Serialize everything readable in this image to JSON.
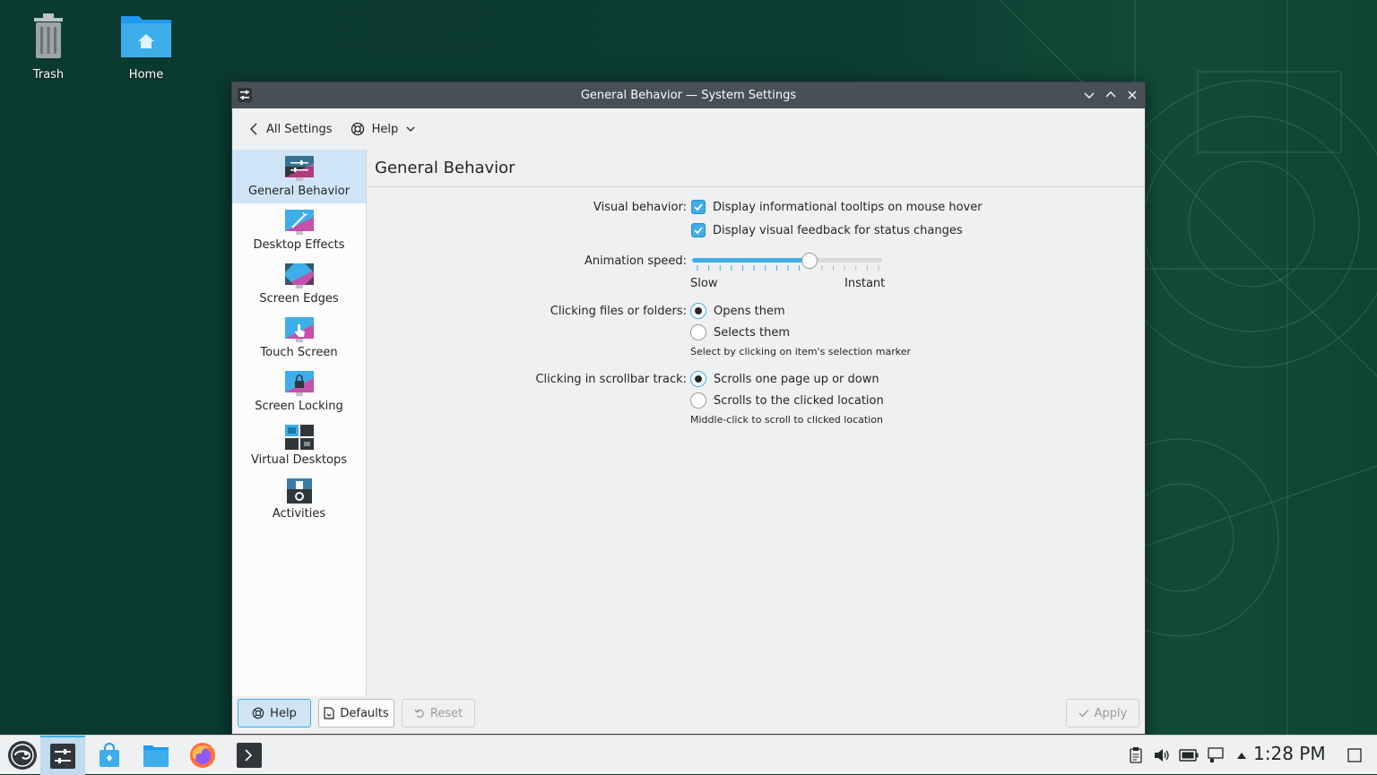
{
  "desktop": {
    "icons": [
      {
        "label": "Trash",
        "icon": "trash-icon"
      },
      {
        "label": "Home",
        "icon": "home-folder-icon"
      }
    ]
  },
  "window": {
    "title": "General Behavior — System Settings",
    "toolbar": {
      "back_label": "All Settings",
      "help_label": "Help"
    },
    "sidebar": {
      "items": [
        {
          "label": "General Behavior",
          "active": true
        },
        {
          "label": "Desktop Effects"
        },
        {
          "label": "Screen Edges"
        },
        {
          "label": "Touch Screen"
        },
        {
          "label": "Screen Locking"
        },
        {
          "label": "Virtual Desktops"
        },
        {
          "label": "Activities"
        }
      ]
    },
    "page": {
      "title": "General Behavior",
      "visual_behavior": {
        "label": "Visual behavior:",
        "options": [
          {
            "label": "Display informational tooltips on mouse hover",
            "checked": true
          },
          {
            "label": "Display visual feedback for status changes",
            "checked": true
          }
        ]
      },
      "animation_speed": {
        "label": "Animation speed:",
        "min_label": "Slow",
        "max_label": "Instant",
        "value_fraction": 0.62
      },
      "clicking_files": {
        "label": "Clicking files or folders:",
        "options": [
          {
            "label": "Opens them",
            "selected": true
          },
          {
            "label": "Selects them",
            "selected": false
          }
        ],
        "hint": "Select by clicking on item's selection marker"
      },
      "scrollbar_track": {
        "label": "Clicking in scrollbar track:",
        "options": [
          {
            "label": "Scrolls one page up or down",
            "selected": true
          },
          {
            "label": "Scrolls to the clicked location",
            "selected": false
          }
        ],
        "hint": "Middle-click to scroll to clicked location"
      }
    },
    "buttons": {
      "help": "Help",
      "defaults": "Defaults",
      "reset": "Reset",
      "apply": "Apply"
    }
  },
  "taskbar": {
    "clock": "1:28 PM"
  },
  "colors": {
    "accent": "#3daee9",
    "titlebar": "#475057",
    "window_bg": "#eff0f1"
  }
}
